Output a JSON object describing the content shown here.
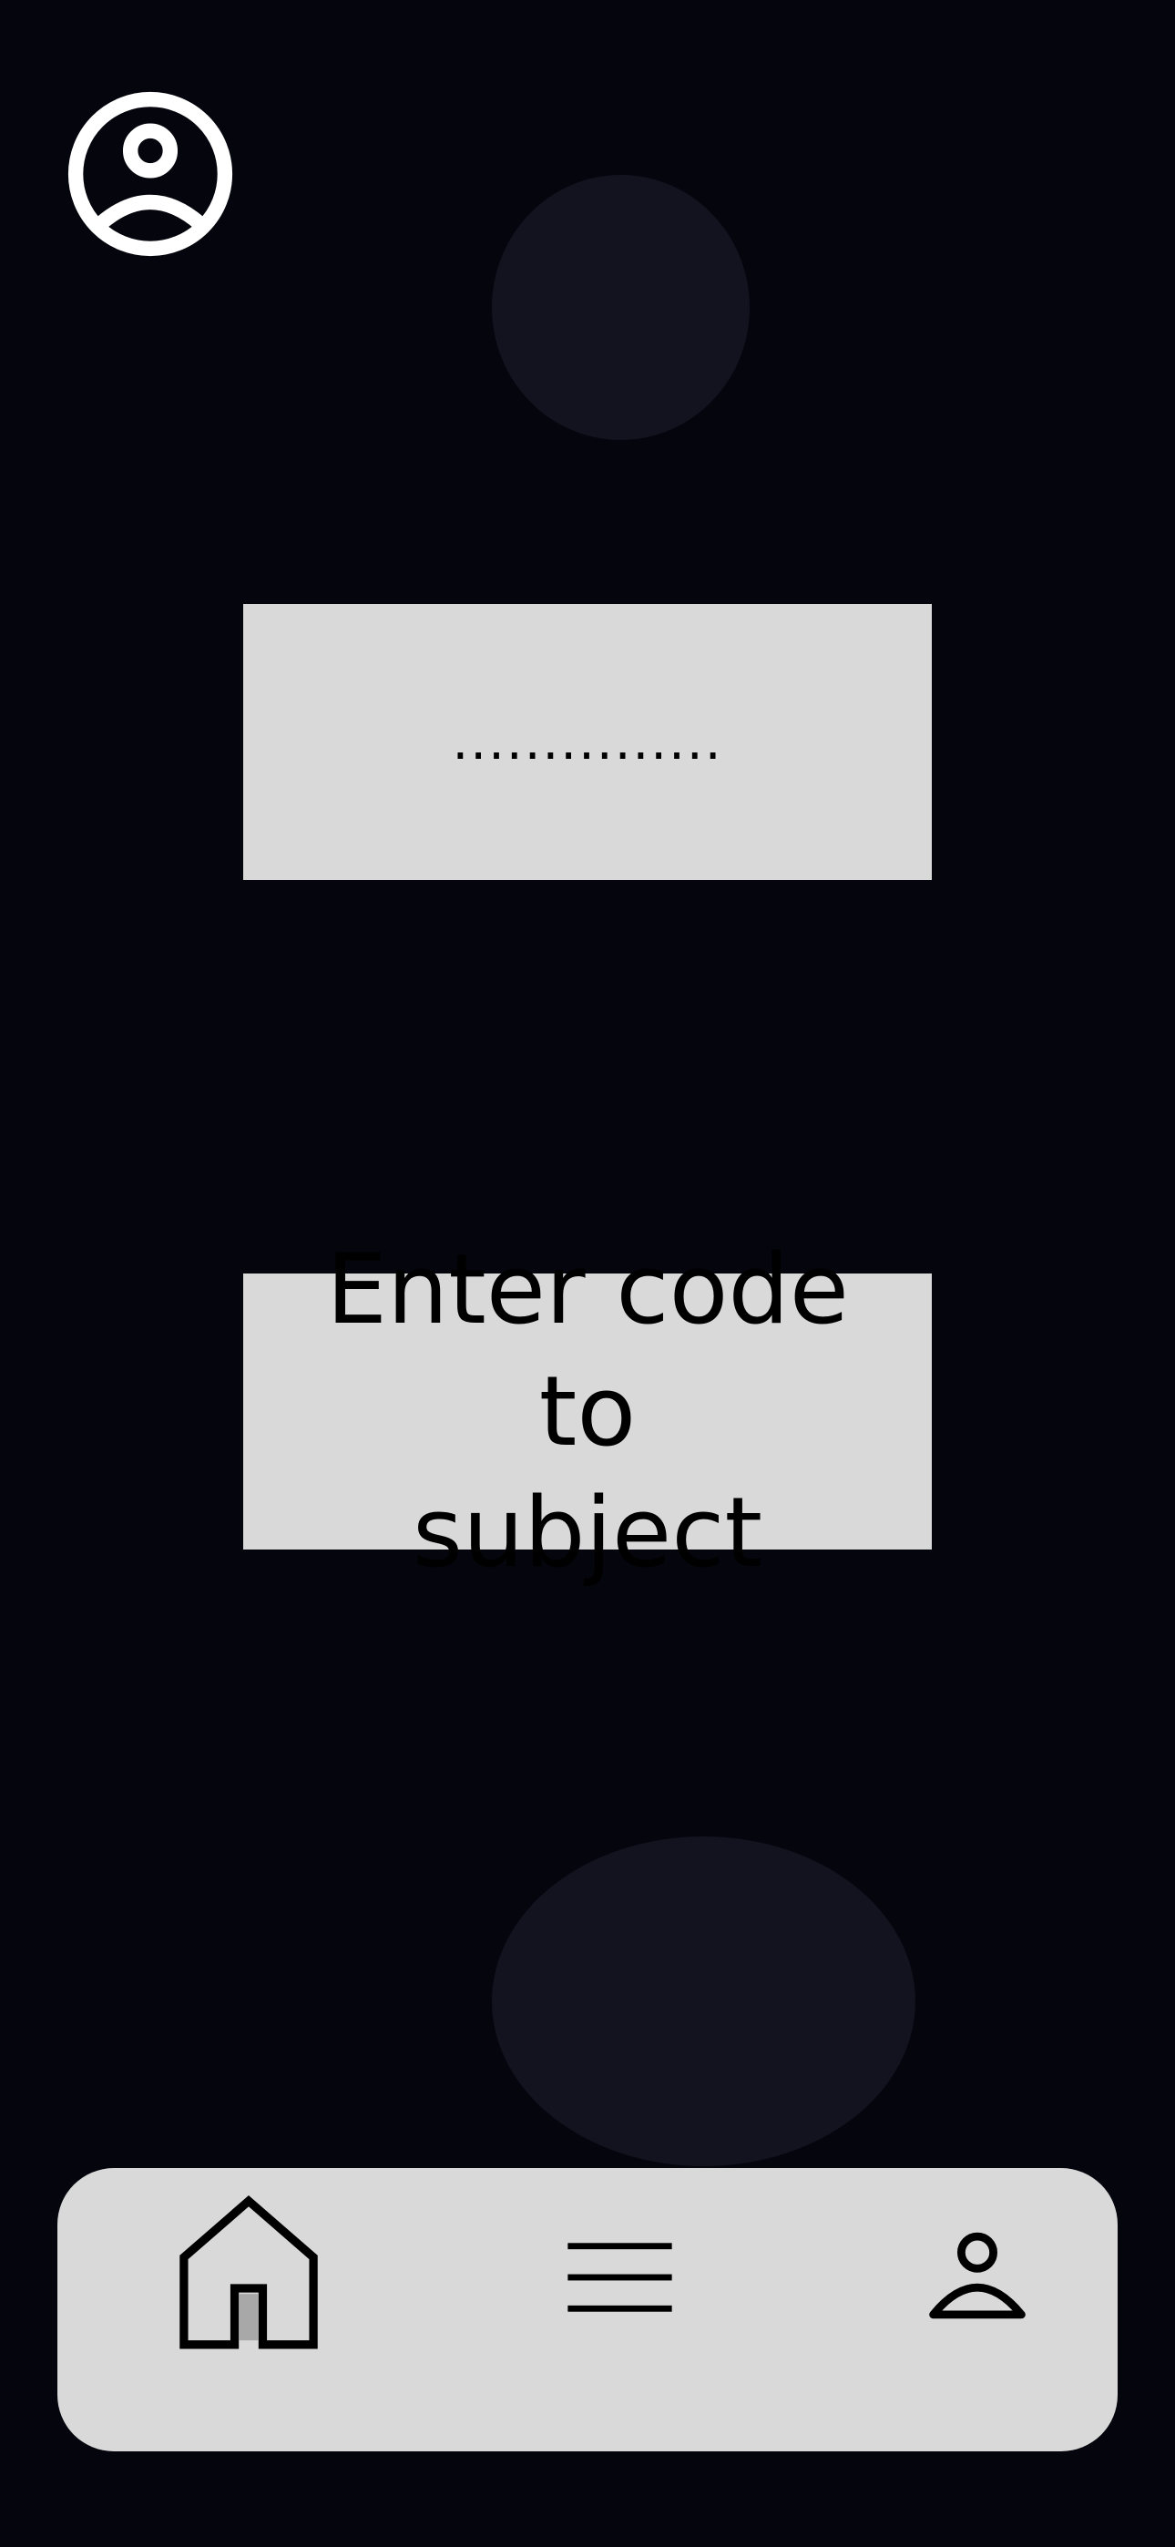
{
  "header": {
    "profile_icon": "account-circle-icon"
  },
  "code_field": {
    "value": "...............",
    "input_type": "password"
  },
  "enter_code_button": {
    "label_line1": "Enter code to",
    "label_line2": "subject"
  },
  "bottom_nav": {
    "items": [
      {
        "id": "home",
        "icon": "home-icon",
        "active": true
      },
      {
        "id": "menu",
        "icon": "menu-icon",
        "active": false
      },
      {
        "id": "profile",
        "icon": "person-icon",
        "active": false
      }
    ]
  },
  "colors": {
    "background": "#05050d",
    "decor": "#13121f",
    "surface": "#d9d9d9",
    "text": "#000000",
    "icon_light": "#ffffff"
  }
}
